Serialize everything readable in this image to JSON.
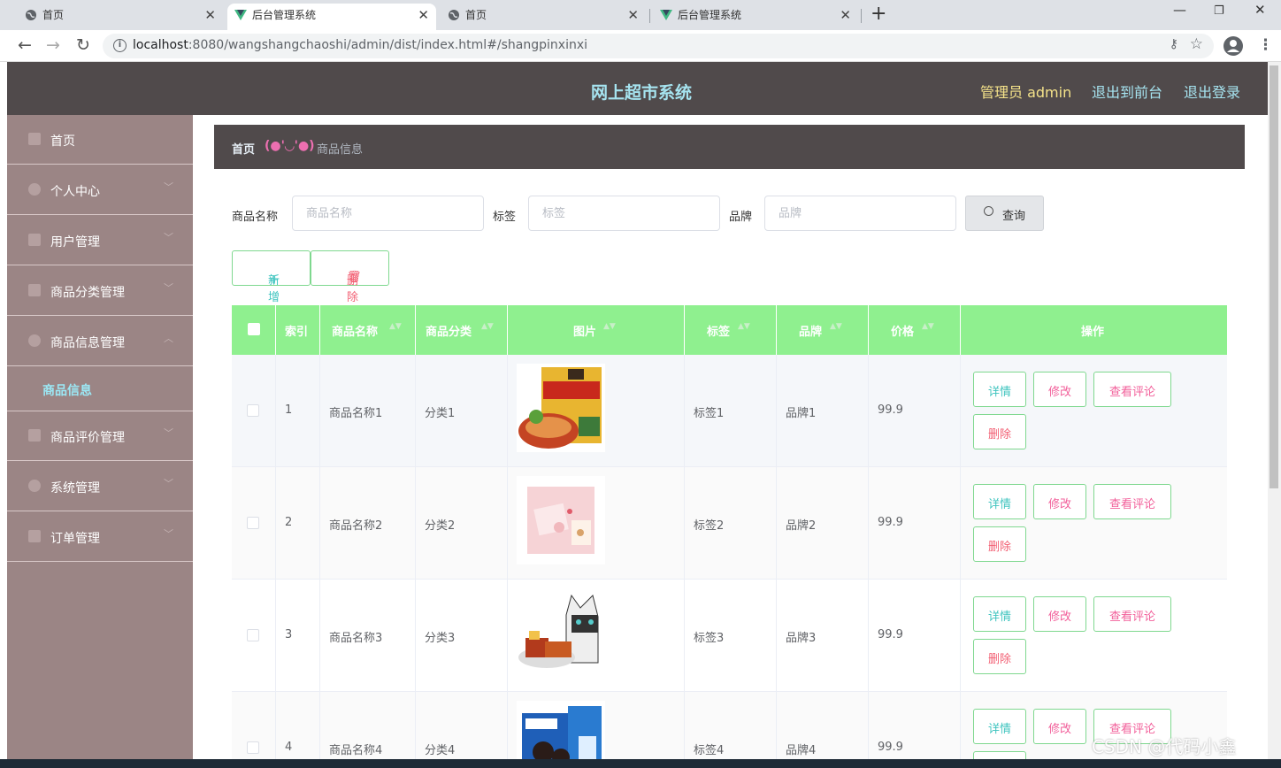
{
  "browser": {
    "tabs": [
      {
        "title": "首页",
        "icon": "globe-icon",
        "active": false
      },
      {
        "title": "后台管理系统",
        "icon": "vue-icon",
        "active": true
      },
      {
        "title": "首页",
        "icon": "globe-icon",
        "active": false
      },
      {
        "title": "后台管理系统",
        "icon": "vue-icon",
        "active": false
      }
    ],
    "url_host": "localhost",
    "url_path": ":8080/wangshangchaoshi/admin/dist/index.html#/shangpinxinxi"
  },
  "header": {
    "title": "网上超市系统",
    "admin_label": "管理员 admin",
    "to_front": "退出到前台",
    "logout": "退出登录"
  },
  "sidebar": {
    "items": [
      {
        "label": "首页",
        "icon": "home-icon",
        "has_arrow": false
      },
      {
        "label": "个人中心",
        "icon": "user-icon",
        "has_arrow": true
      },
      {
        "label": "用户管理",
        "icon": "folder-icon",
        "has_arrow": true
      },
      {
        "label": "商品分类管理",
        "icon": "menu-icon",
        "has_arrow": true
      },
      {
        "label": "商品信息管理",
        "icon": "setting-icon",
        "has_arrow": true,
        "expanded": true
      },
      {
        "label": "商品评价管理",
        "icon": "monitor-icon",
        "has_arrow": true
      },
      {
        "label": "系统管理",
        "icon": "power-icon",
        "has_arrow": true
      },
      {
        "label": "订单管理",
        "icon": "menu-icon",
        "has_arrow": true
      }
    ],
    "sub_item": "商品信息"
  },
  "breadcrumb": {
    "home": "首页",
    "separator": "(●'◡'●)",
    "current": "商品信息"
  },
  "search": {
    "name_label": "商品名称",
    "name_placeholder": "商品名称",
    "tag_label": "标签",
    "tag_placeholder": "标签",
    "brand_label": "品牌",
    "brand_placeholder": "品牌",
    "query_label": "查询"
  },
  "actions": {
    "add_label": "新增",
    "delete_label": "删除"
  },
  "table": {
    "columns": [
      "索引",
      "商品名称",
      "商品分类",
      "图片",
      "标签",
      "品牌",
      "价格",
      "操作"
    ],
    "row_buttons": {
      "detail": "详情",
      "edit": "修改",
      "comments": "查看评论",
      "delete": "删除"
    },
    "rows": [
      {
        "index": "1",
        "name": "商品名称1",
        "category": "分类1",
        "tag": "标签1",
        "brand": "品牌1",
        "price": "99.9"
      },
      {
        "index": "2",
        "name": "商品名称2",
        "category": "分类2",
        "tag": "标签2",
        "brand": "品牌2",
        "price": "99.9"
      },
      {
        "index": "3",
        "name": "商品名称3",
        "category": "分类3",
        "tag": "标签3",
        "brand": "品牌3",
        "price": "99.9"
      },
      {
        "index": "4",
        "name": "商品名称4",
        "category": "分类4",
        "tag": "标签4",
        "brand": "品牌4",
        "price": "99.9"
      }
    ]
  },
  "watermark": "CSDN @代码小鑫"
}
